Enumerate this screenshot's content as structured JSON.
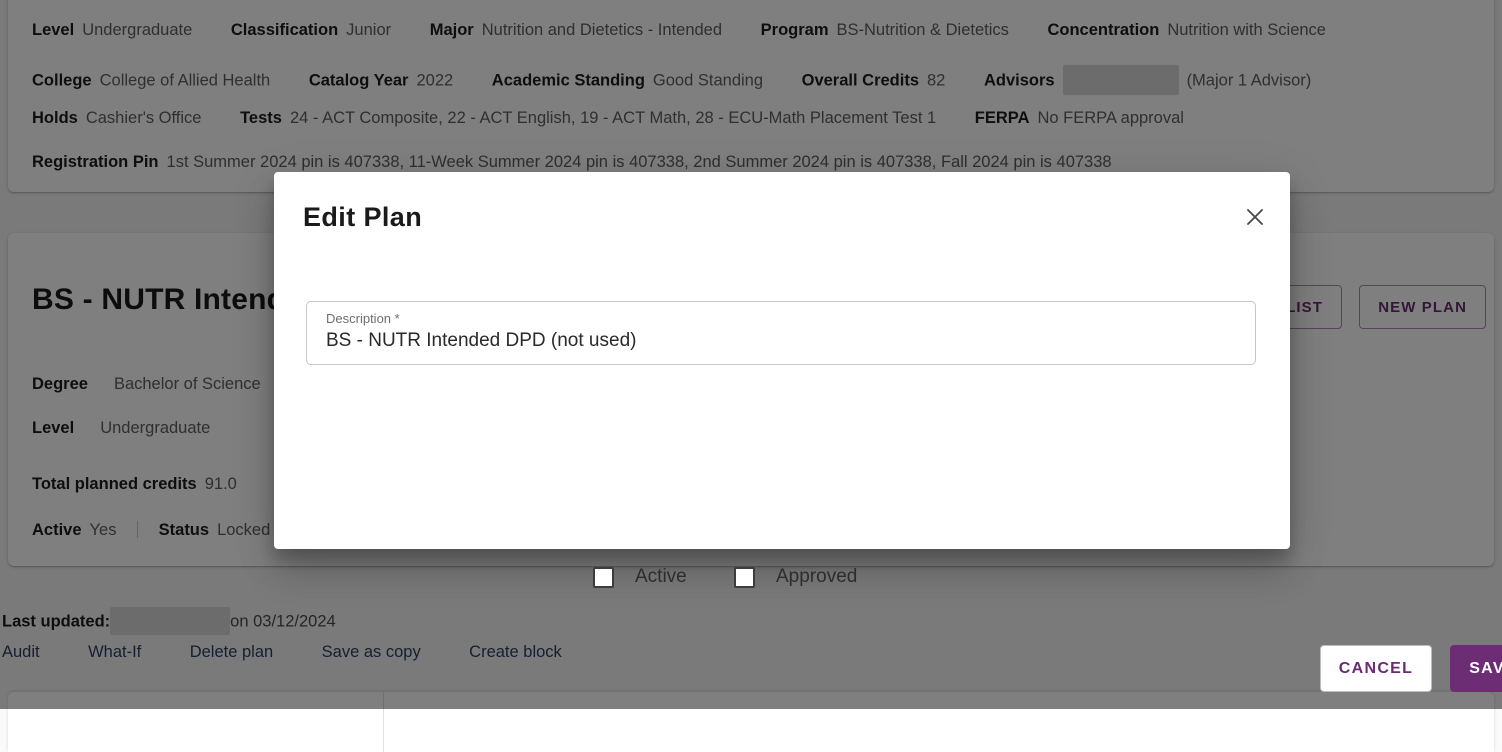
{
  "student_info": {
    "rows": [
      [
        {
          "key": "Level",
          "value": "Undergraduate"
        },
        {
          "key": "Classification",
          "value": "Junior"
        },
        {
          "key": "Major",
          "value": "Nutrition and Dietetics - Intended"
        },
        {
          "key": "Program",
          "value": "BS-Nutrition & Dietetics"
        },
        {
          "key": "Concentration",
          "value": "Nutrition with Science"
        }
      ],
      [
        {
          "key": "College",
          "value": "College of Allied Health"
        },
        {
          "key": "Catalog Year",
          "value": "2022"
        },
        {
          "key": "Academic Standing",
          "value": "Good Standing"
        },
        {
          "key": "Overall Credits",
          "value": "82"
        },
        {
          "key": "Advisors",
          "value": "(Major 1 Advisor)",
          "redacted": true
        }
      ],
      [
        {
          "key": "Holds",
          "value": "Cashier's Office"
        },
        {
          "key": "Tests",
          "value": "24 - ACT Composite, 22 - ACT English, 19 - ACT Math, 28 - ECU-Math Placement Test 1"
        },
        {
          "key": "FERPA",
          "value": "No FERPA approval"
        }
      ],
      [
        {
          "key": "Registration Pin",
          "value": "1st Summer 2024 pin is 407338, 11-Week Summer 2024 pin is 407338, 2nd Summer 2024 pin is 407338, Fall 2024 pin is 407338"
        }
      ]
    ]
  },
  "plan": {
    "title": "BS - NUTR Intended DPD (not used)",
    "plan_list_button": "PLAN LIST",
    "new_plan_button": "NEW PLAN",
    "degree_key": "Degree",
    "degree_value": "Bachelor of Science",
    "level_key": "Level",
    "level_value": "Undergraduate",
    "credits_key": "Total planned credits",
    "credits_value": "91.0",
    "active_key": "Active",
    "active_value": "Yes",
    "status_key": "Status",
    "status_value": "Locked"
  },
  "footer": {
    "last_updated_label": "Last updated:",
    "last_updated_on": "on 03/12/2024",
    "links": [
      {
        "label": "Audit"
      },
      {
        "label": "What-If"
      },
      {
        "label": "Delete plan"
      },
      {
        "label": "Save as copy"
      },
      {
        "label": "Create block"
      }
    ]
  },
  "dialog": {
    "title": "Edit Plan",
    "close_icon": "close-icon",
    "description_label": "Description *",
    "description_value": "BS - NUTR Intended DPD (not used)",
    "description_placeholder": "Description",
    "checkboxes": [
      {
        "label": "Active",
        "checked": false
      },
      {
        "label": "Approved",
        "checked": false
      }
    ],
    "cancel_label": "CANCEL",
    "save_label": "SAVE"
  },
  "colors": {
    "accent_purple": "#6d2d74",
    "link_blue": "#2c3e63",
    "scrim": "rgba(0,0,0,0.50)"
  }
}
